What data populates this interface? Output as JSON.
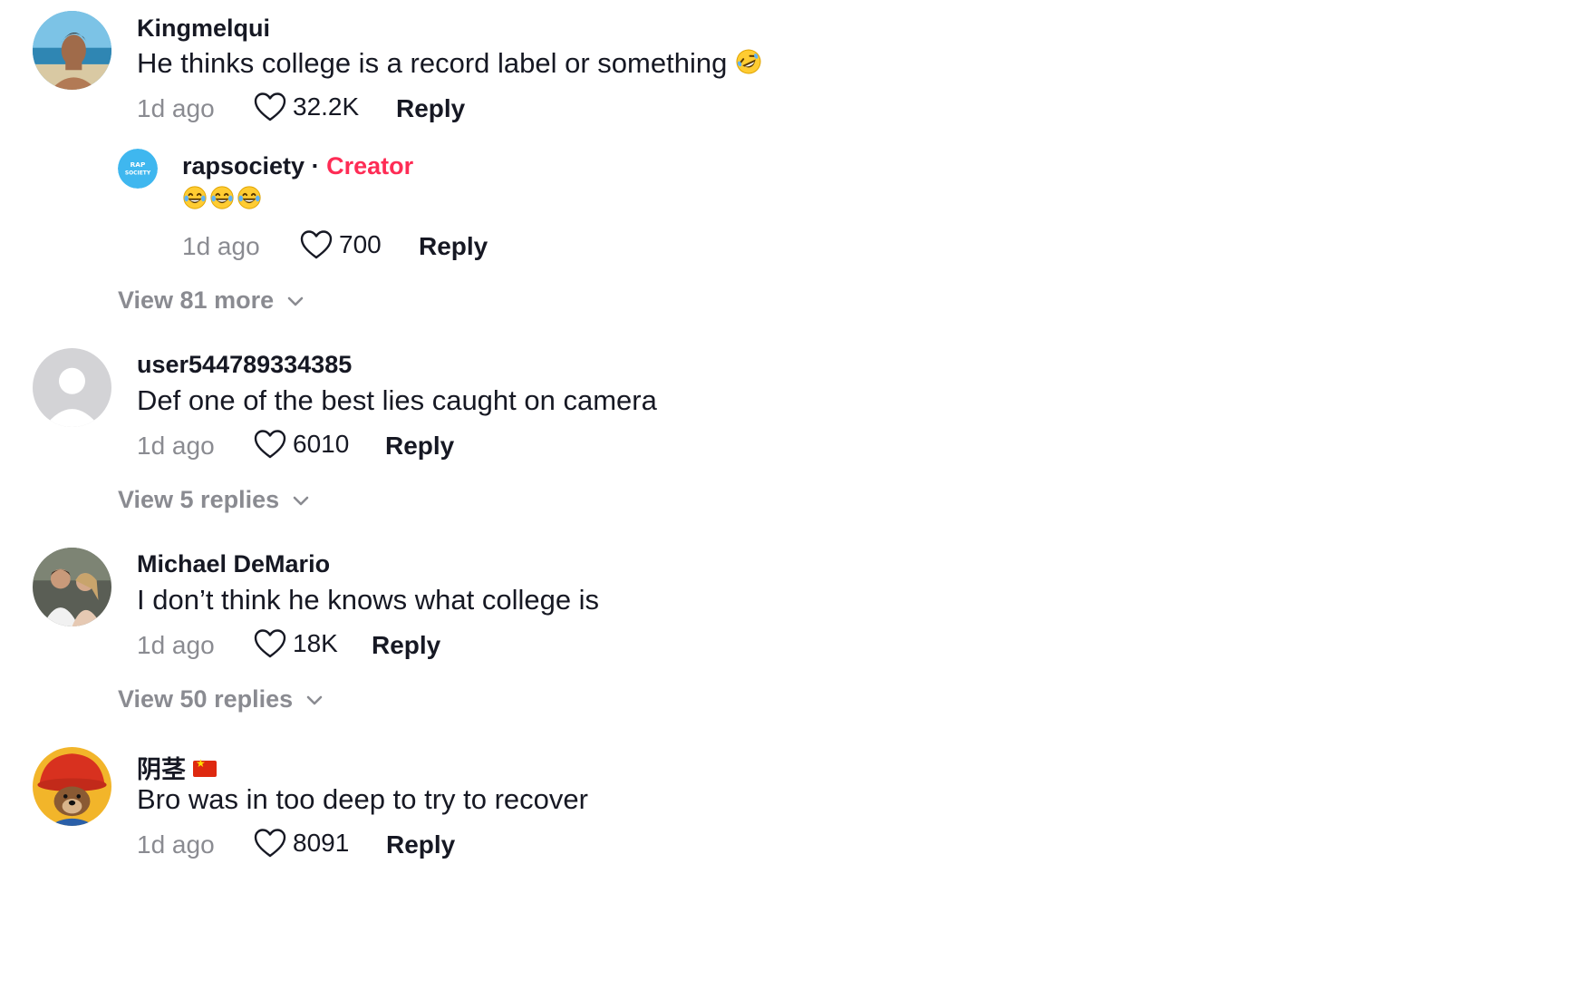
{
  "comments": [
    {
      "username": "Kingmelqui",
      "text": "He thinks college is a record label or something",
      "emoji": "rolling-on-floor-laughing",
      "time": "1d ago",
      "likes": "32.2K",
      "reply_label": "Reply",
      "replies": [
        {
          "username": "rapsociety",
          "separator": "·",
          "badge": "Creator",
          "text": "😂😂😂",
          "time": "1d ago",
          "likes": "700",
          "reply_label": "Reply",
          "avatar_text": "RAP SOCIETY"
        }
      ],
      "view_more_label": "View 81 more"
    },
    {
      "username": "user544789334385",
      "text": "Def one of the best lies caught on camera",
      "time": "1d ago",
      "likes": "6010",
      "reply_label": "Reply",
      "view_more_label": "View 5 replies"
    },
    {
      "username": "Michael DeMario",
      "text": "I don’t think he knows what college is",
      "time": "1d ago",
      "likes": "18K",
      "reply_label": "Reply",
      "view_more_label": "View 50 replies"
    },
    {
      "username": "阴茎",
      "flag": "china-flag-icon",
      "text": "Bro was in too deep to try to recover",
      "time": "1d ago",
      "likes": "8091",
      "reply_label": "Reply"
    }
  ],
  "colors": {
    "creator": "#fe2c55",
    "muted": "#8a8b91",
    "text": "#161823",
    "rapsociety_avatar": "#3fb7ef"
  }
}
